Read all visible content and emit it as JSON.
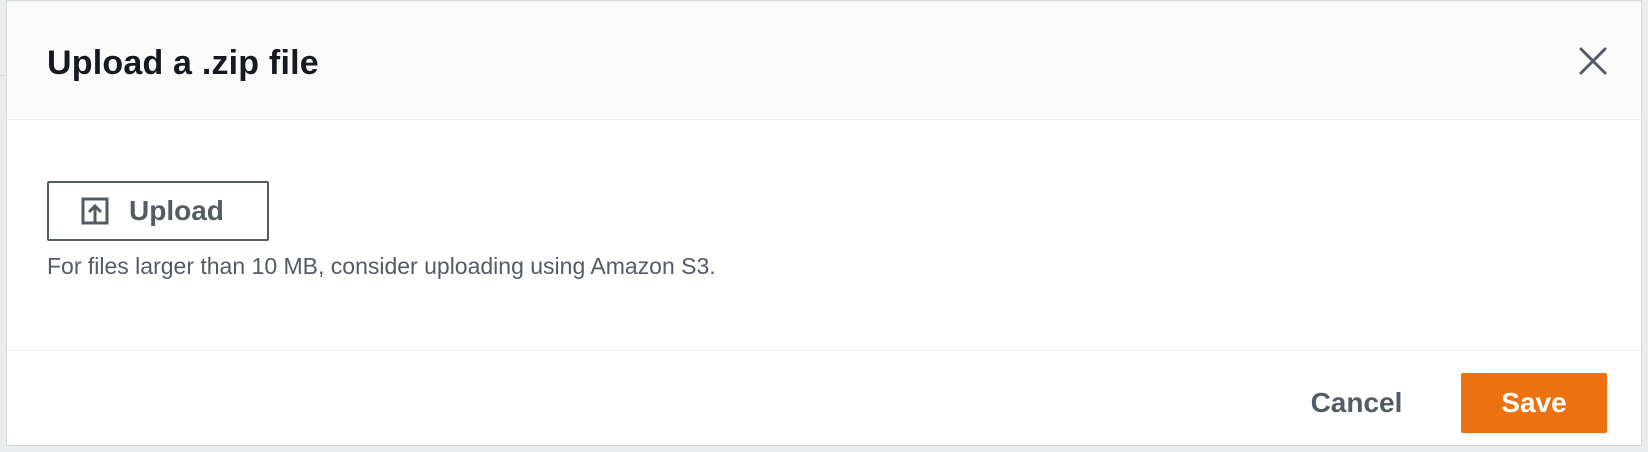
{
  "dialog": {
    "title": "Upload a .zip file",
    "close_icon": "close-icon"
  },
  "body": {
    "upload_button_label": "Upload",
    "upload_icon": "upload-icon",
    "hint": "For files larger than 10 MB, consider uploading using Amazon S3."
  },
  "footer": {
    "cancel_label": "Cancel",
    "save_label": "Save"
  },
  "colors": {
    "primary_accent": "#ec7211",
    "text_dark": "#16191f",
    "text_secondary": "#545b64"
  }
}
